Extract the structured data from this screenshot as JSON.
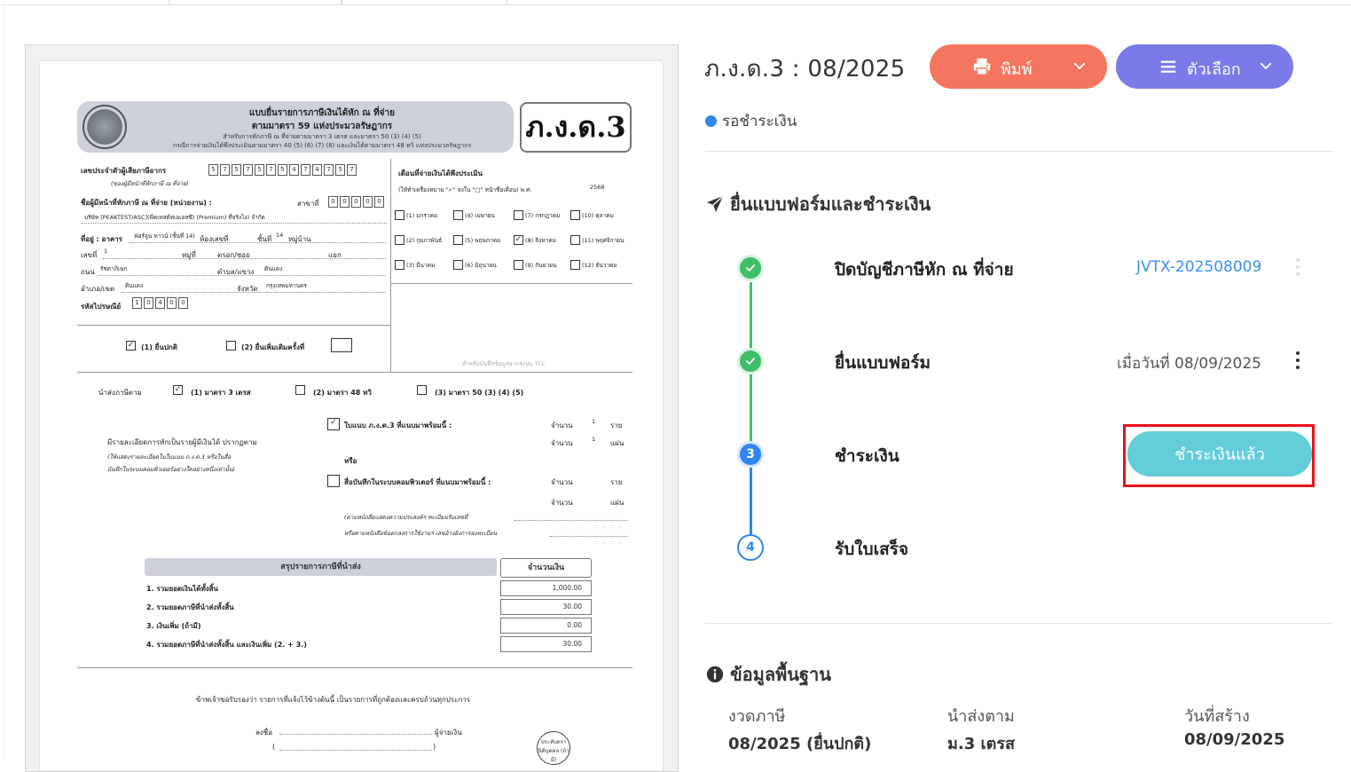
{
  "header": {
    "title": "ภ.ง.ด.3 : 08/2025",
    "print_label": "พิมพ์",
    "options_label": "ตัวเลือก",
    "status": "รอชำระเงิน",
    "colors": {
      "print": "#f4765e",
      "options": "#7a7ae8",
      "status_dot": "#2f86f0"
    }
  },
  "submission": {
    "title": "ยื่นแบบฟอร์มและชำระเงิน",
    "steps": [
      {
        "label": "ปิดบัญชีภาษีหัก ณ ที่จ่าย",
        "meta": "JVTX-202508009",
        "state": "done",
        "number": ""
      },
      {
        "label": "ยื่นแบบฟอร์ม",
        "meta": "เมื่อวันที่ 08/09/2025",
        "state": "done",
        "number": ""
      },
      {
        "label": "ชำระเงิน",
        "meta": "",
        "state": "active",
        "number": "3"
      },
      {
        "label": "รับใบเสร็จ",
        "meta": "",
        "state": "todo",
        "number": "4"
      }
    ],
    "paid_button": "ชำระเงินแล้ว"
  },
  "basic_info": {
    "title": "ข้อมูลพื้นฐาน",
    "fields": [
      {
        "label": "งวดภาษี",
        "value": "08/2025 (ยื่นปกติ)"
      },
      {
        "label": "นำส่งตาม",
        "value": "ม.3 เตรส"
      },
      {
        "label": "วันที่สร้าง",
        "value": "08/09/2025"
      }
    ]
  },
  "document": {
    "form_code": "ภ.ง.ด.3",
    "head_line1": "แบบยื่นรายการภาษีเงินได้หัก ณ ที่จ่าย",
    "head_line2": "ตามมาตรา 59 แห่งประมวลรัษฎากร",
    "head_line3": "สำหรับการหักภาษี ณ ที่จ่ายตามมาตรา 3 เตรส และมาตรา 50 (3) (4) (5)",
    "head_line4": "กรณีการจ่ายเงินได้พึงประเมินตามมาตรา 40 (5) (6) (7) (8) และเงินได้ตามมาตรา 48 ทวิ แห่งประมวลรัษฎากร",
    "tax_id_label": "เลขประจำตัวผู้เสียภาษีอากร",
    "tax_id_note": "(ของผู้มีหน้าที่หักภาษี ณ ที่จ่าย)",
    "tax_id_digits": [
      "5",
      "7",
      "5",
      "7",
      "5",
      "7",
      "5",
      "4",
      "7",
      "4",
      "7",
      "5",
      "7"
    ],
    "payer_label": "ชื่อผู้มีหน้าที่หักภาษี ณ ที่จ่าย (หน่วยงาน) :",
    "branch_label": "สาขาที่",
    "branch_digits": [
      "0",
      "0",
      "0",
      "0",
      "0"
    ],
    "payer_name": "บริษัท [PEAKTEST/ASC](พีคเทสต์ทเอเอสซี) (Premium) ที่จริงไง) จำกัด",
    "address_label": "ที่อยู่ : อาคาร",
    "building": "ฟอร์จูน ทาวน์ (ชั้นที่ 14)",
    "room_label": "ห้องเลขที่",
    "floor_label": "ชั้นที่",
    "floor": "14",
    "village_label": "หมู่บ้าน",
    "no_label": "เลขที่",
    "no_value": "1",
    "moo_label": "หมู่ที่",
    "soi_label": "ตรอก/ซอย",
    "yaek_label": "แยก",
    "road_label": "ถนน",
    "road": "รัชดาภิเษก",
    "subdistrict_label": "ตำบล/แขวง",
    "subdistrict": "ดินแดง",
    "district_label": "อำเภอ/เขต",
    "district": "ดินแดง",
    "province_label": "จังหวัด",
    "province": "กรุงเทพมหานคร",
    "zip_label": "รหัสไปรษณีย์",
    "zip_digits": [
      "1",
      "0",
      "4",
      "0",
      "0"
    ],
    "month_title": "เดือนที่จ่ายเงินได้พึงประเมิน",
    "month_hint": "(ให้ทำเครื่องหมาย \"✓\" ลงใน \"□\" หน้าชื่อเดือน) พ.ศ.",
    "year": "2568",
    "months": [
      "(1) มกราคม",
      "(4) เมษายน",
      "(7) กรกฎาคม",
      "(10) ตุลาคม",
      "(2) กุมภาพันธ์",
      "(5) พฤษภาคม",
      "(8) สิงหาคม",
      "(11) พฤศจิกายน",
      "(3) มีนาคม",
      "(6) มิถุนายน",
      "(9) กันยายน",
      "(12) ธันวาคม"
    ],
    "filing_normal": "(1) ยื่นปกติ",
    "filing_extra": "(2) ยื่นเพิ่มเติมครั้งที่",
    "official_note": "สำหรับบันทึกข้อมูลจากระบบ TCL",
    "remit_label": "นำส่งภาษีตาม",
    "remit_options": [
      "(1) มาตรา 3 เตรส",
      "(2) มาตรา 48 ทวิ",
      "(3) มาตรา 50 (3) (4) (5)"
    ],
    "detail_text1": "มีรายละเอียดการหักเป็นรายผู้มีเงินได้ ปรากฏตาม",
    "detail_text2": "(ให้แสดงรายละเอียดในใบแนบ ภ.ง.ด.3 หรือในสื่อ",
    "detail_text3": "บันทึกในระบบคอมพิวเตอร์อย่างใดอย่างหนึ่งเท่านั้น)",
    "attach_label": "ใบแนบ ภ.ง.ด.3 ที่แนบมาพร้อมนี้ :",
    "or_label": "หรือ",
    "media_label": "สื่อบันทึกในระบบคอมพิวเตอร์ ที่แนบมาพร้อมนี้ :",
    "count_label": "จำนวน",
    "unit_person": "ราย",
    "unit_sheet": "แผ่น",
    "attach_persons": "1",
    "attach_sheets": "1",
    "media_note1": "(ตามหนังสือแสดงความประสงค์ฯ ทะเบียนรับเลขที่",
    "media_note2": "หรือตามหนังสือข้อตกลงการใช้งานฯ เลขอ้างอิงการลงทะเบียน",
    "summary_title": "สรุปรายการภาษีที่นำส่ง",
    "amount_title": "จำนวนเงิน",
    "summary_rows": [
      {
        "label": "1. รวมยอดเงินได้ทั้งสิ้น",
        "amount": "1,000.00"
      },
      {
        "label": "2. รวมยอดภาษีที่นำส่งทั้งสิ้น",
        "amount": "30.00"
      },
      {
        "label": "3. เงินเพิ่ม (ถ้ามี)",
        "amount": "0.00"
      },
      {
        "label": "4. รวมยอดภาษีที่นำส่งทั้งสิ้น และเงินเพิ่ม (2. + 3.)",
        "amount": "30.00"
      }
    ],
    "certify": "ข้าพเจ้าขอรับรองว่า รายการที่แจ้งไว้ข้างต้นนี้ เป็นรายการที่ถูกต้องและครบถ้วนทุกประการ",
    "sign_label": "ลงชื่อ",
    "payer_role": "ผู้จ่ายเงิน",
    "stamp_text": "ประทับตรานิติบุคคล (ถ้ามี)"
  }
}
